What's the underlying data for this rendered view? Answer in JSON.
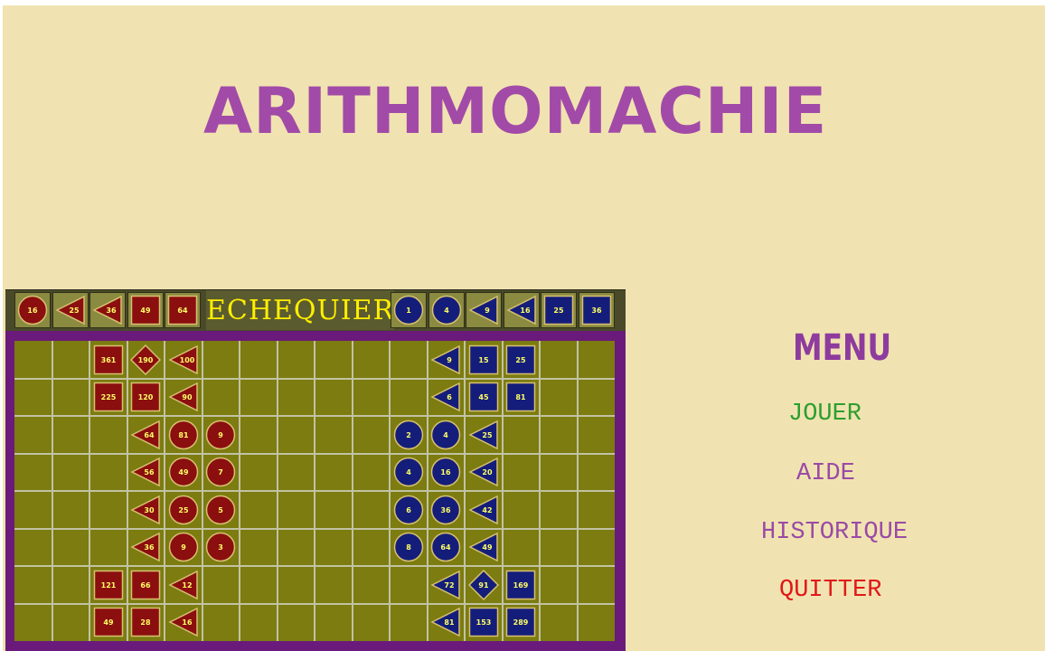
{
  "title": "ARITHMOMACHIE",
  "board_label": "ECHEQUIER",
  "colors": {
    "background": "#f0e3b1",
    "title": "#a24aa8",
    "board": "#7c7c10",
    "board_frame": "#6a1a7a",
    "red_piece": "#8b0f0f",
    "blue_piece": "#141e7a",
    "piece_number": "#ffff66"
  },
  "captured": {
    "red": [
      {
        "shape": "circle",
        "value": "16"
      },
      {
        "shape": "triangle",
        "value": "25"
      },
      {
        "shape": "triangle",
        "value": "36"
      },
      {
        "shape": "square",
        "value": "49"
      },
      {
        "shape": "square",
        "value": "64"
      }
    ],
    "blue": [
      {
        "shape": "circle",
        "value": "1"
      },
      {
        "shape": "circle",
        "value": "4"
      },
      {
        "shape": "triangle",
        "value": "9"
      },
      {
        "shape": "triangle",
        "value": "16"
      },
      {
        "shape": "square",
        "value": "25"
      },
      {
        "shape": "square",
        "value": "36"
      }
    ]
  },
  "board": {
    "columns": 16,
    "rows": 8,
    "pieces": [
      {
        "color": "red",
        "shape": "square",
        "value": "361",
        "row": 0,
        "col": 2
      },
      {
        "color": "red",
        "shape": "diamond",
        "value": "190",
        "row": 0,
        "col": 3
      },
      {
        "color": "red",
        "shape": "triangle",
        "value": "100",
        "row": 0,
        "col": 4
      },
      {
        "color": "red",
        "shape": "square",
        "value": "225",
        "row": 1,
        "col": 2
      },
      {
        "color": "red",
        "shape": "square",
        "value": "120",
        "row": 1,
        "col": 3
      },
      {
        "color": "red",
        "shape": "triangle",
        "value": "90",
        "row": 1,
        "col": 4
      },
      {
        "color": "red",
        "shape": "triangle",
        "value": "64",
        "row": 2,
        "col": 3
      },
      {
        "color": "red",
        "shape": "circle",
        "value": "81",
        "row": 2,
        "col": 4
      },
      {
        "color": "red",
        "shape": "circle",
        "value": "9",
        "row": 2,
        "col": 5
      },
      {
        "color": "red",
        "shape": "triangle",
        "value": "56",
        "row": 3,
        "col": 3
      },
      {
        "color": "red",
        "shape": "circle",
        "value": "49",
        "row": 3,
        "col": 4
      },
      {
        "color": "red",
        "shape": "circle",
        "value": "7",
        "row": 3,
        "col": 5
      },
      {
        "color": "red",
        "shape": "triangle",
        "value": "30",
        "row": 4,
        "col": 3
      },
      {
        "color": "red",
        "shape": "circle",
        "value": "25",
        "row": 4,
        "col": 4
      },
      {
        "color": "red",
        "shape": "circle",
        "value": "5",
        "row": 4,
        "col": 5
      },
      {
        "color": "red",
        "shape": "triangle",
        "value": "36",
        "row": 5,
        "col": 3
      },
      {
        "color": "red",
        "shape": "circle",
        "value": "9",
        "row": 5,
        "col": 4
      },
      {
        "color": "red",
        "shape": "circle",
        "value": "3",
        "row": 5,
        "col": 5
      },
      {
        "color": "red",
        "shape": "square",
        "value": "121",
        "row": 6,
        "col": 2
      },
      {
        "color": "red",
        "shape": "square",
        "value": "66",
        "row": 6,
        "col": 3
      },
      {
        "color": "red",
        "shape": "triangle",
        "value": "12",
        "row": 6,
        "col": 4
      },
      {
        "color": "red",
        "shape": "square",
        "value": "49",
        "row": 7,
        "col": 2
      },
      {
        "color": "red",
        "shape": "square",
        "value": "28",
        "row": 7,
        "col": 3
      },
      {
        "color": "red",
        "shape": "triangle",
        "value": "16",
        "row": 7,
        "col": 4
      },
      {
        "color": "blue",
        "shape": "triangle",
        "value": "9",
        "row": 0,
        "col": 11
      },
      {
        "color": "blue",
        "shape": "square",
        "value": "15",
        "row": 0,
        "col": 12
      },
      {
        "color": "blue",
        "shape": "square",
        "value": "25",
        "row": 0,
        "col": 13
      },
      {
        "color": "blue",
        "shape": "triangle",
        "value": "6",
        "row": 1,
        "col": 11
      },
      {
        "color": "blue",
        "shape": "square",
        "value": "45",
        "row": 1,
        "col": 12
      },
      {
        "color": "blue",
        "shape": "square",
        "value": "81",
        "row": 1,
        "col": 13
      },
      {
        "color": "blue",
        "shape": "circle",
        "value": "2",
        "row": 2,
        "col": 10
      },
      {
        "color": "blue",
        "shape": "circle",
        "value": "4",
        "row": 2,
        "col": 11
      },
      {
        "color": "blue",
        "shape": "triangle",
        "value": "25",
        "row": 2,
        "col": 12
      },
      {
        "color": "blue",
        "shape": "circle",
        "value": "4",
        "row": 3,
        "col": 10
      },
      {
        "color": "blue",
        "shape": "circle",
        "value": "16",
        "row": 3,
        "col": 11
      },
      {
        "color": "blue",
        "shape": "triangle",
        "value": "20",
        "row": 3,
        "col": 12
      },
      {
        "color": "blue",
        "shape": "circle",
        "value": "6",
        "row": 4,
        "col": 10
      },
      {
        "color": "blue",
        "shape": "circle",
        "value": "36",
        "row": 4,
        "col": 11
      },
      {
        "color": "blue",
        "shape": "triangle",
        "value": "42",
        "row": 4,
        "col": 12
      },
      {
        "color": "blue",
        "shape": "circle",
        "value": "8",
        "row": 5,
        "col": 10
      },
      {
        "color": "blue",
        "shape": "circle",
        "value": "64",
        "row": 5,
        "col": 11
      },
      {
        "color": "blue",
        "shape": "triangle",
        "value": "49",
        "row": 5,
        "col": 12
      },
      {
        "color": "blue",
        "shape": "triangle",
        "value": "72",
        "row": 6,
        "col": 11
      },
      {
        "color": "blue",
        "shape": "diamond",
        "value": "91",
        "row": 6,
        "col": 12
      },
      {
        "color": "blue",
        "shape": "square",
        "value": "169",
        "row": 6,
        "col": 13
      },
      {
        "color": "blue",
        "shape": "triangle",
        "value": "81",
        "row": 7,
        "col": 11
      },
      {
        "color": "blue",
        "shape": "square",
        "value": "153",
        "row": 7,
        "col": 12
      },
      {
        "color": "blue",
        "shape": "square",
        "value": "289",
        "row": 7,
        "col": 13
      }
    ]
  },
  "menu": {
    "title": "MENU",
    "items": [
      {
        "label": "JOUER",
        "color": "#2e9e2e"
      },
      {
        "label": "AIDE",
        "color": "#9a4aa6"
      },
      {
        "label": "HISTORIQUE",
        "color": "#9a4aa6"
      },
      {
        "label": "QUITTER",
        "color": "#e01818"
      }
    ]
  }
}
